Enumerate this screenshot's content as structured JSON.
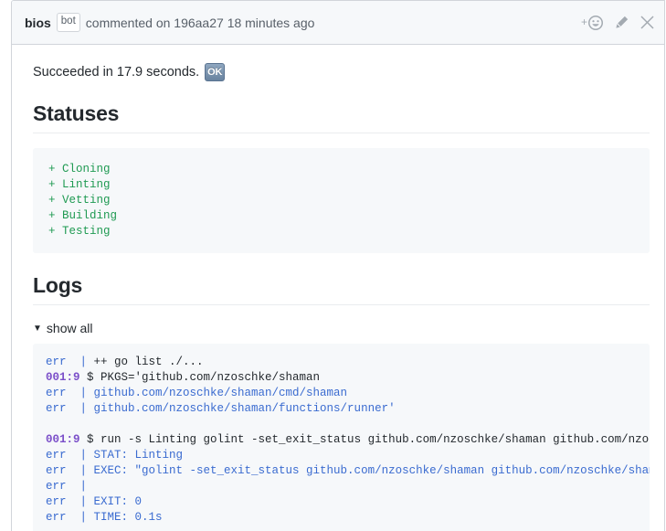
{
  "comment": {
    "author": "bios",
    "bot_badge": "bot",
    "meta_prefix": "commented on",
    "commit": "196aa27",
    "timestamp": "18 minutes ago",
    "actions": {
      "add_reaction": "add-reaction",
      "edit": "edit-comment",
      "close": "close"
    }
  },
  "body": {
    "result_text": "Succeeded in 17.9 seconds.",
    "result_badge": "OK",
    "statuses_heading": "Statuses",
    "statuses": [
      "+ Cloning",
      "+ Linting",
      "+ Vetting",
      "+ Building",
      "+ Testing"
    ],
    "logs_heading": "Logs",
    "show_all_label": "show all",
    "show_all_triangle": "▼",
    "logs": [
      {
        "prefix": "err  | ",
        "prefix_kind": "err",
        "text": "++ go list ./...",
        "text_kind": "dark"
      },
      {
        "prefix": "001:9 ",
        "prefix_kind": "time",
        "text": "$ PKGS='github.com/nzoschke/shaman",
        "text_kind": "dark"
      },
      {
        "prefix": "err  | ",
        "prefix_kind": "err",
        "text": "github.com/nzoschke/shaman/cmd/shaman",
        "text_kind": "blue"
      },
      {
        "prefix": "err  | ",
        "prefix_kind": "err",
        "text": "github.com/nzoschke/shaman/functions/runner'",
        "text_kind": "blue"
      },
      {
        "prefix": "",
        "prefix_kind": "none",
        "text": "",
        "text_kind": "dark"
      },
      {
        "prefix": "001:9 ",
        "prefix_kind": "time",
        "text": "$ run -s Linting golint -set_exit_status github.com/nzoschke/shaman github.com/nzoschke/",
        "text_kind": "dark"
      },
      {
        "prefix": "err  | ",
        "prefix_kind": "err",
        "text": "STAT: Linting",
        "text_kind": "blue"
      },
      {
        "prefix": "err  | ",
        "prefix_kind": "err",
        "text": "EXEC: \"golint -set_exit_status github.com/nzoschke/shaman github.com/nzoschke/shaman/cmd",
        "text_kind": "blue"
      },
      {
        "prefix": "err  | ",
        "prefix_kind": "err",
        "text": "",
        "text_kind": "blue"
      },
      {
        "prefix": "err  | ",
        "prefix_kind": "err",
        "text": "EXIT: 0",
        "text_kind": "blue"
      },
      {
        "prefix": "err  | ",
        "prefix_kind": "err",
        "text": "TIME: 0.1s",
        "text_kind": "blue"
      }
    ]
  },
  "colors": {
    "header_bg": "#f6f8fa",
    "border": "#d1d5da",
    "status_green": "#1f9a52",
    "log_blue": "#3a6bd0",
    "log_purple": "#7b4fc9",
    "text": "#24292e",
    "muted": "#586069"
  }
}
